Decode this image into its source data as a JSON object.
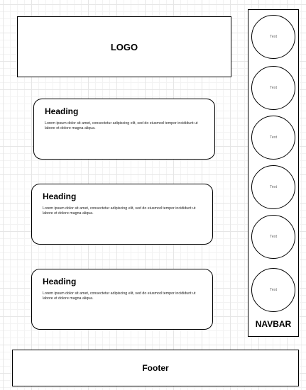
{
  "logo": {
    "label": "LOGO"
  },
  "cards": [
    {
      "heading": "Heading",
      "body": "Lorem ipsum dolor sit amet, consectetur adipiscing elit, sed do eiusmod tempor incididunt ut labore et dolore magna aliqua."
    },
    {
      "heading": "Heading",
      "body": "Lorem ipsum dolor sit amet, consectetur adipiscing elit, sed do eiusmod tempor incididunt ut labore et dolore magna aliqua."
    },
    {
      "heading": "Heading",
      "body": "Lorem ipsum dolor sit amet, consectetur adipiscing elit, sed do eiusmod tempor incididunt ut labore et dolore magna aliqua."
    }
  ],
  "navbar": {
    "title": "NAVBAR",
    "items": [
      {
        "label": "Text"
      },
      {
        "label": "Text"
      },
      {
        "label": "Text"
      },
      {
        "label": "Text"
      },
      {
        "label": "Text"
      },
      {
        "label": "Text"
      }
    ]
  },
  "footer": {
    "label": "Footer"
  }
}
